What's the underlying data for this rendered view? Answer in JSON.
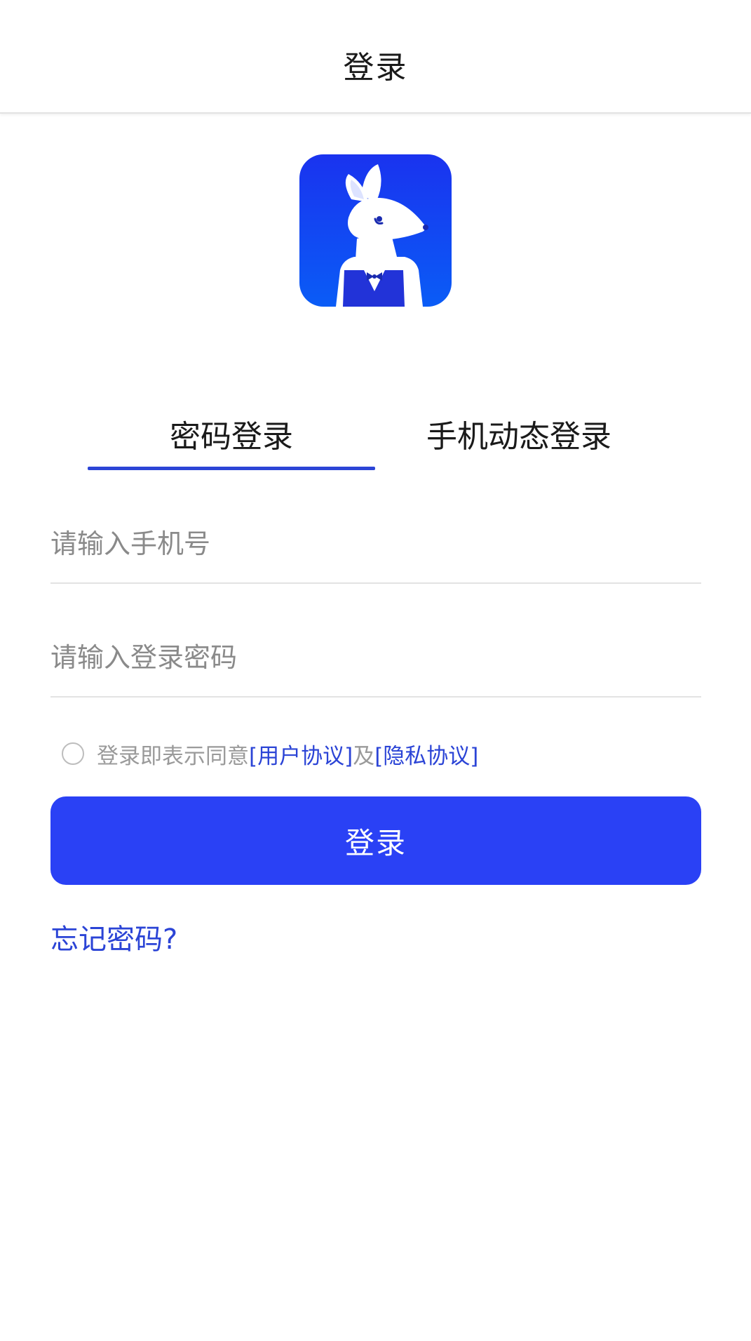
{
  "header": {
    "title": "登录"
  },
  "logo": {
    "icon": "kangaroo-mascot-logo"
  },
  "tabs": [
    {
      "label": "密码登录",
      "active": true
    },
    {
      "label": "手机动态登录",
      "active": false
    }
  ],
  "form": {
    "phone_placeholder": "请输入手机号",
    "password_placeholder": "请输入登录密码"
  },
  "agreement": {
    "prefix": "登录即表示同意",
    "user_agreement": "[用户协议]",
    "and": "及",
    "privacy_agreement": "[隐私协议]",
    "checked": false
  },
  "login_button": {
    "label": "登录"
  },
  "forgot_password": {
    "label": "忘记密码?"
  },
  "colors": {
    "accent": "#2a41f5",
    "link": "#2b44d6",
    "placeholder": "#8a8a8a",
    "divider": "#e3e3e3"
  }
}
